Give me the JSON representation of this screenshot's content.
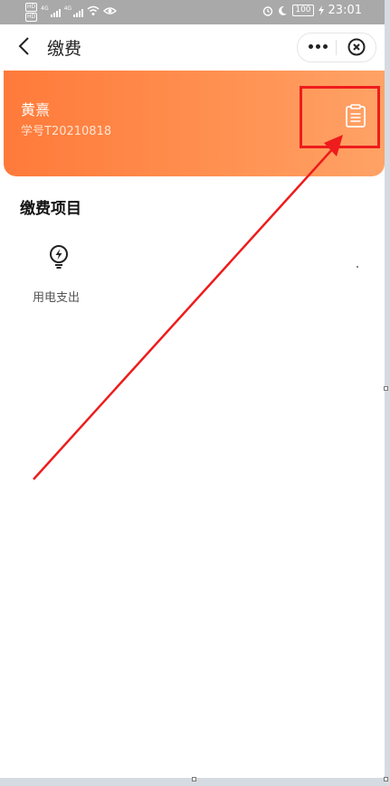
{
  "status_bar": {
    "hd_top": "HD",
    "hd_bottom": "HD",
    "sim1": "4G",
    "sim2": "4G",
    "battery": "100",
    "time": "23:01"
  },
  "nav": {
    "title": "缴费"
  },
  "profile": {
    "name": "黄熹",
    "student_id": "学号T20210818"
  },
  "section": {
    "title": "缴费项目"
  },
  "items": [
    {
      "label": "用电支出",
      "icon": "lightning-bulb-icon"
    }
  ],
  "colors": {
    "card_gradient_start": "#ff7a3a",
    "card_gradient_end": "#ffa266",
    "annotation_red": "#ee1c1c"
  }
}
